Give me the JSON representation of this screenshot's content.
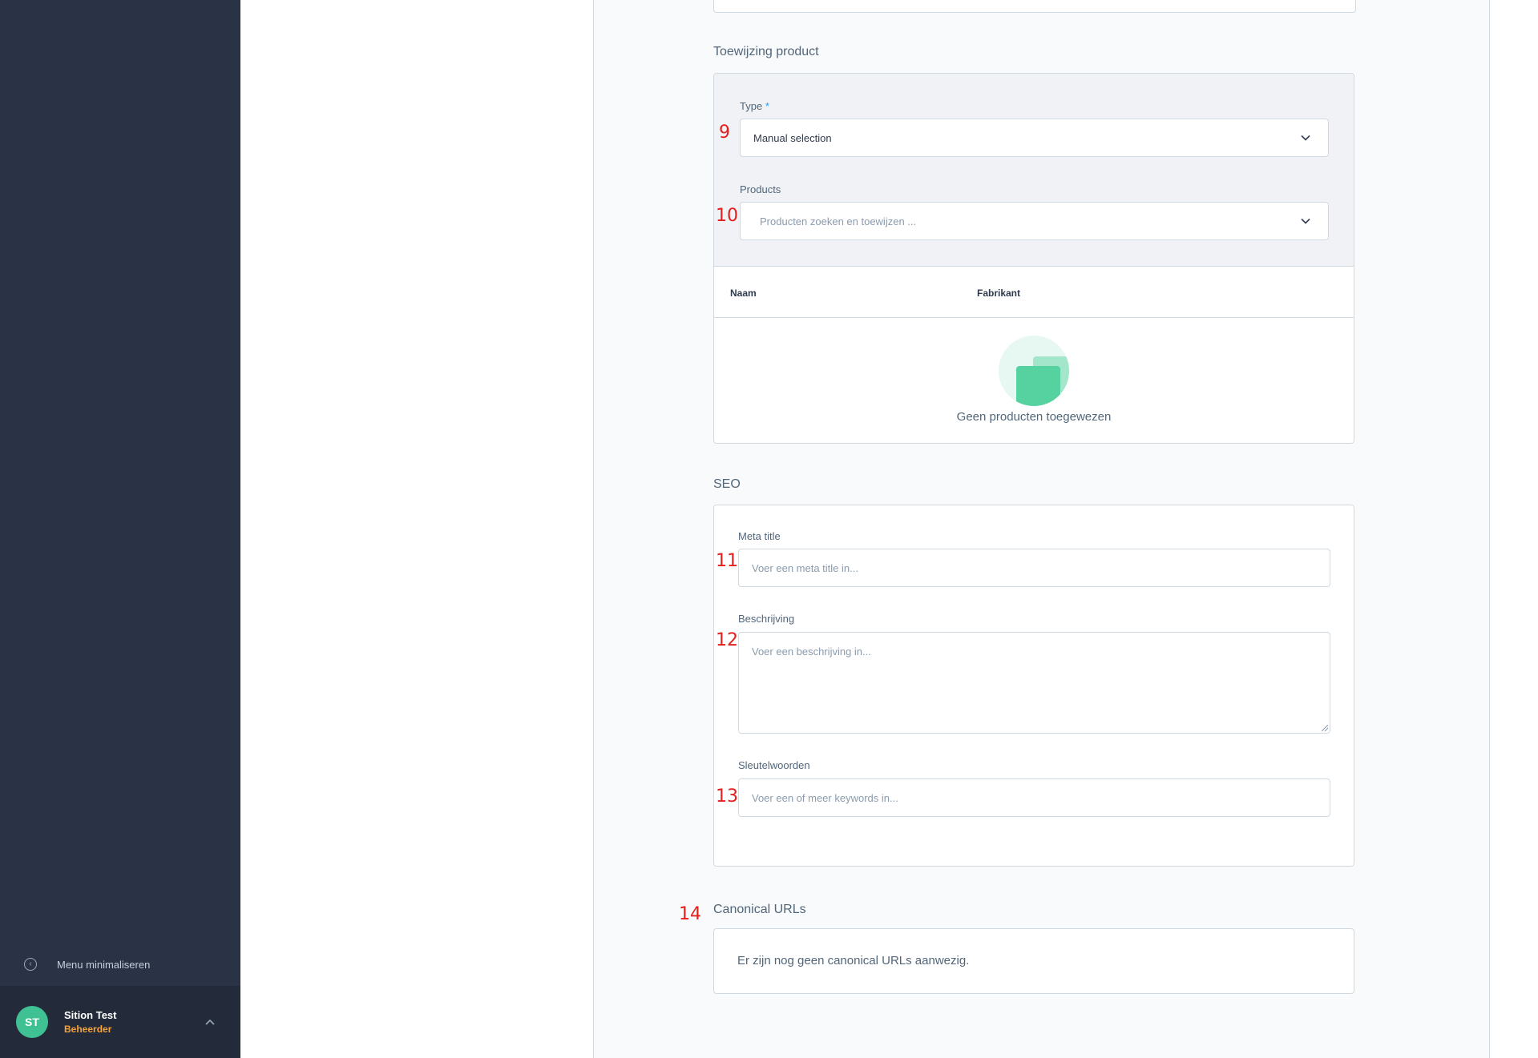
{
  "sidebar": {
    "collapse_label": "Menu minimaliseren",
    "user": {
      "initials": "ST",
      "name": "Sition Test",
      "role": "Beheerder"
    }
  },
  "assignment": {
    "title": "Toewijzing product",
    "type_label": "Type",
    "type_required_mark": "*",
    "type_value": "Manual selection",
    "products_label": "Products",
    "products_placeholder": "Producten zoeken en toewijzen ...",
    "table_headers": [
      "Naam",
      "Fabrikant"
    ],
    "empty_text": "Geen producten toegewezen"
  },
  "seo": {
    "title": "SEO",
    "meta_title_label": "Meta title",
    "meta_title_placeholder": "Voer een meta title in...",
    "description_label": "Beschrijving",
    "description_placeholder": "Voer een beschrijving in...",
    "keywords_label": "Sleutelwoorden",
    "keywords_placeholder": "Voer een of meer keywords in..."
  },
  "canonical": {
    "title": "Canonical URLs",
    "empty_text": "Er zijn nog geen canonical URLs aanwezig."
  },
  "annotations": [
    "9",
    "10",
    "11",
    "12",
    "13",
    "14"
  ],
  "colors": {
    "sidebar_bg": "#2a3345",
    "avatar_bg": "#3fc193",
    "role_color": "#f5a33b",
    "annotation_red": "#e41d1d"
  }
}
